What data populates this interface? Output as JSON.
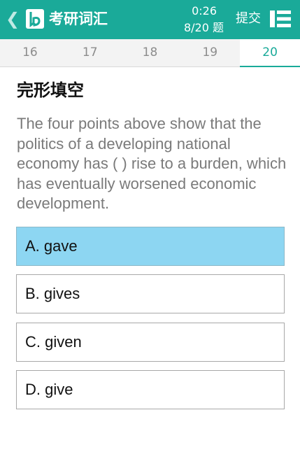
{
  "header": {
    "app_title": "考研词汇",
    "timer": "0:26",
    "progress": "8/20 题",
    "submit_label": "提交",
    "bar_color": "#1aaa99",
    "icons": {
      "back": "chevron-left-icon",
      "logo": "bookmark-logo-icon",
      "list": "numbered-list-icon"
    }
  },
  "tabs": [
    "16",
    "17",
    "18",
    "19",
    "20"
  ],
  "active_tab": "20",
  "section_title": "完形填空",
  "question_text": "The four points above show that the politics of a developing national economy has (    ) rise to a burden, which has eventually worsened economic development.",
  "options": [
    {
      "label": "A. gave",
      "selected": true
    },
    {
      "label": "B. gives",
      "selected": false
    },
    {
      "label": "C. given",
      "selected": false
    },
    {
      "label": "D. give",
      "selected": false
    }
  ],
  "colors": {
    "accent": "#1aaa99",
    "selected_option": "#8dd6f2"
  }
}
